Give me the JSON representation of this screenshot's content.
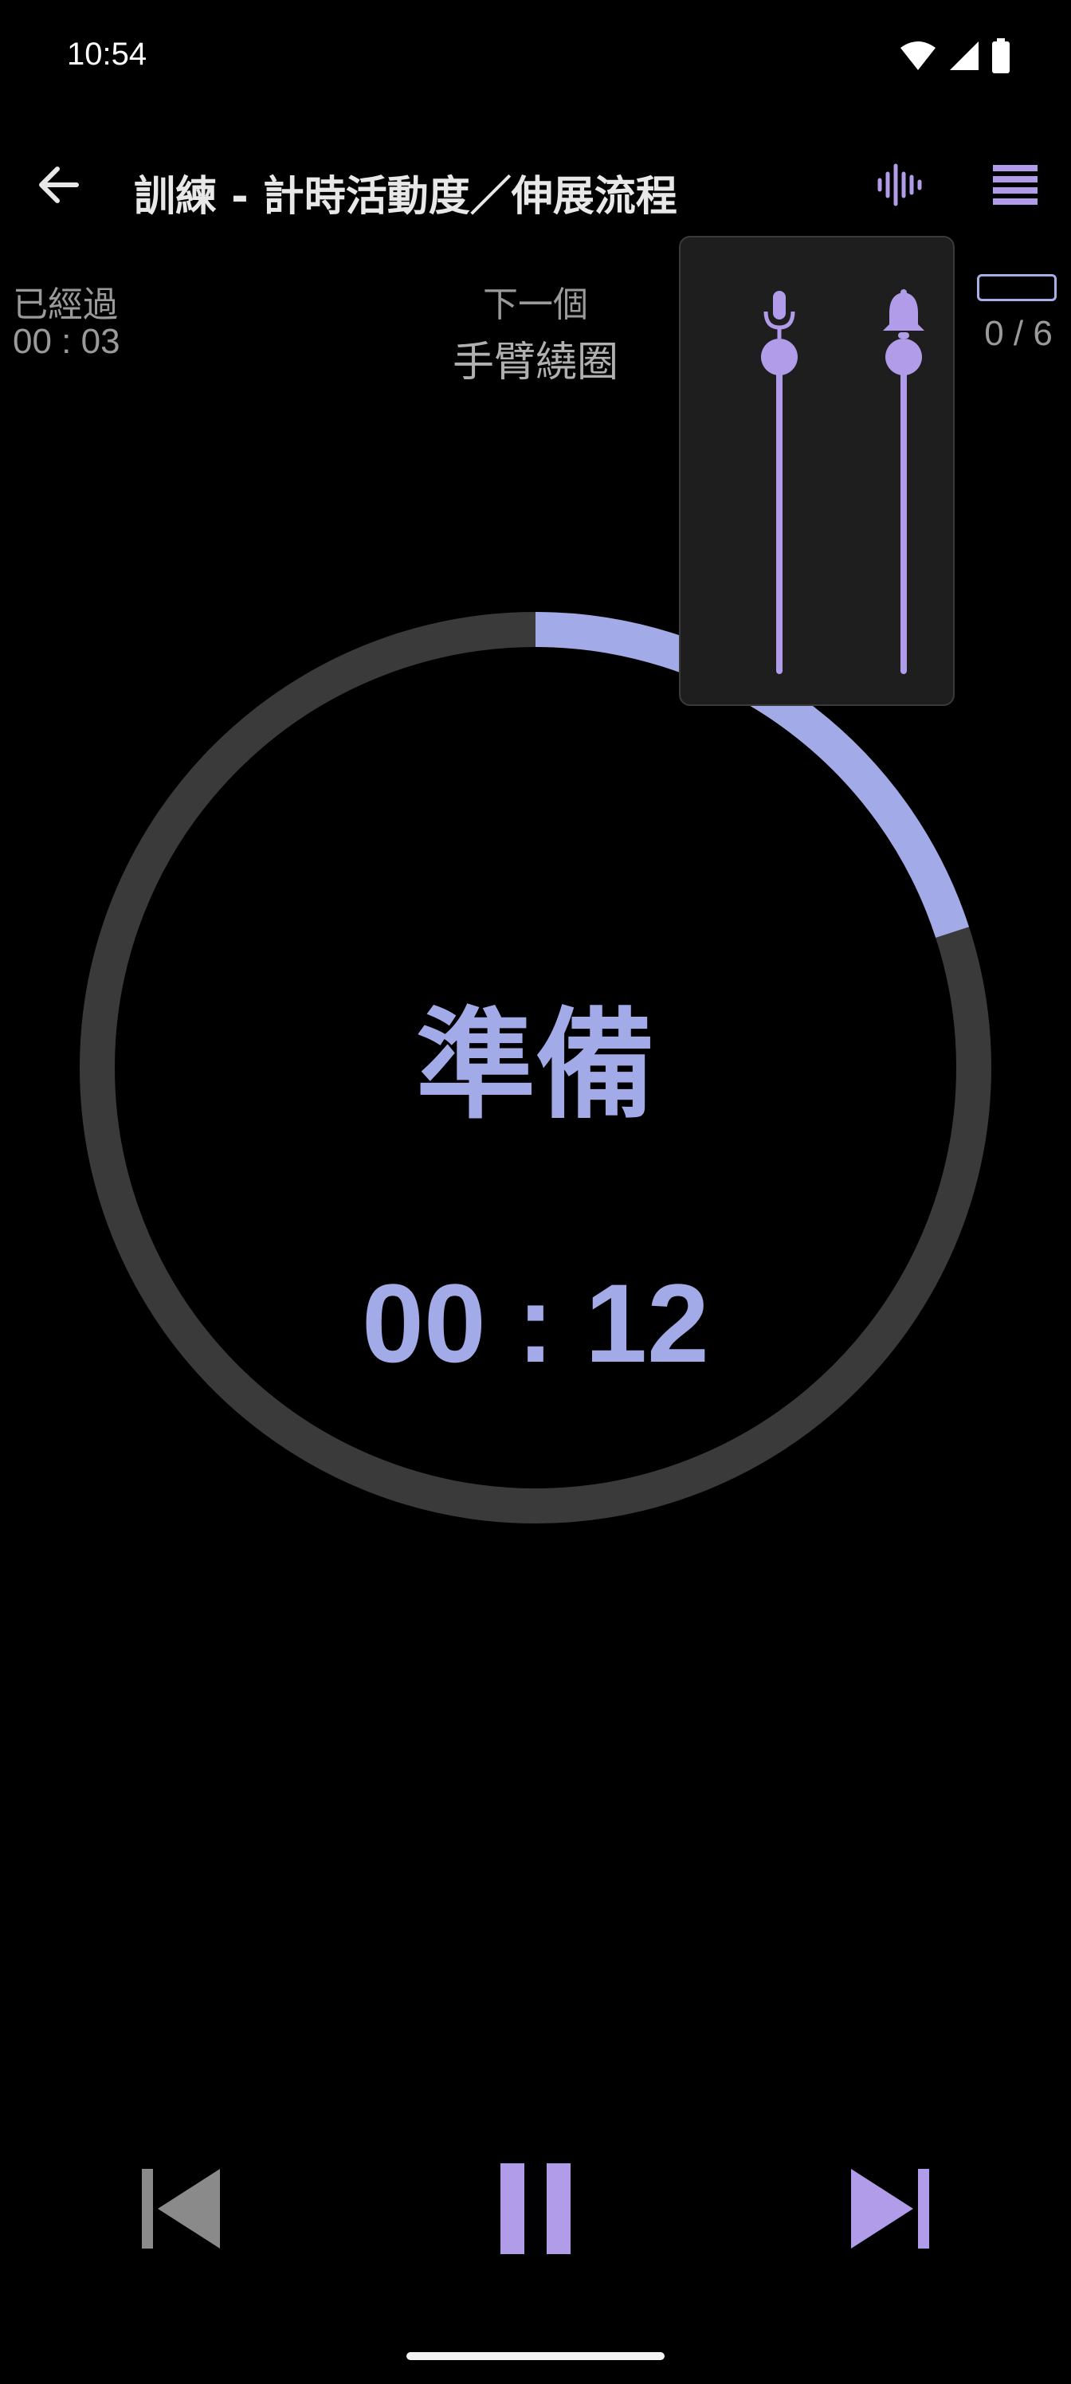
{
  "status_bar": {
    "time": "10:54",
    "icons": [
      "wifi-icon",
      "cell-signal-icon",
      "battery-icon"
    ]
  },
  "app_bar": {
    "title": "訓練 - 計時活動度／伸展流程",
    "back_icon": "arrow-back-icon",
    "voice_icon": "voice-waveform-icon",
    "list_icon": "list-icon"
  },
  "info": {
    "elapsed_label": "已經過",
    "elapsed_value": "00 : 03",
    "next_label": "下一個",
    "next_value": "手臂繞圈",
    "progress_count": "0 / 6",
    "progress_fraction": 0.0
  },
  "timer": {
    "phase": "準備",
    "countdown": "00 : 12",
    "ring_progress": 0.2
  },
  "volume_panel": {
    "voice_icon": "microphone-icon",
    "bell_icon": "bell-icon",
    "voice_level": 1.0,
    "bell_level": 1.0
  },
  "controls": {
    "prev_icon": "skip-previous-icon",
    "pause_icon": "pause-icon",
    "next_icon": "skip-next-icon"
  },
  "colors": {
    "accent": "#a3aae8",
    "control_accent": "#b09ce8",
    "ring_track": "#3a3a3a",
    "secondary_text": "#9a9a9a",
    "disabled_control": "#8a8a8a"
  }
}
